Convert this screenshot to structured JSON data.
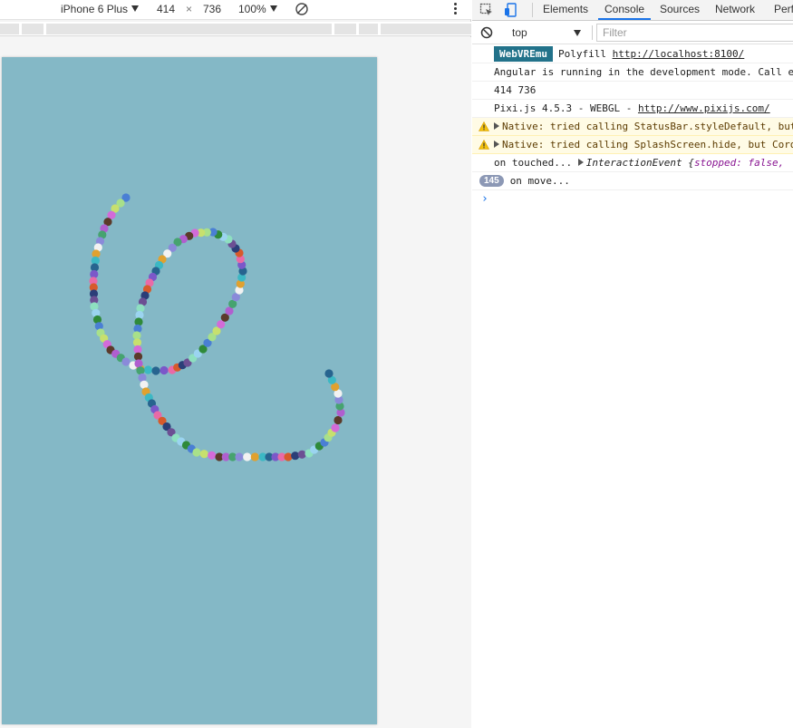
{
  "device_toolbar": {
    "device": "iPhone 6 Plus",
    "width": "414",
    "times": "×",
    "height": "736",
    "zoom": "100%"
  },
  "canvas": {
    "background": "#84b8c6",
    "dot_colors": [
      "#4a7fd4",
      "#d36bd8",
      "#46a36f",
      "#e0a12f",
      "#7b58c9",
      "#2b3e78",
      "#9bd4f0",
      "#a8e08a",
      "#5b3a2a",
      "#8a8ad9",
      "#3cb8c4",
      "#e96aa7",
      "#6c4f93",
      "#2f8a3a",
      "#c7e06e",
      "#b05fcf",
      "#f2f2f2",
      "#27648f",
      "#d75a2b",
      "#8ee0c0"
    ]
  },
  "devtools": {
    "tabs": [
      {
        "label": "Elements"
      },
      {
        "label": "Console"
      },
      {
        "label": "Sources"
      },
      {
        "label": "Network"
      },
      {
        "label": "Perf"
      }
    ],
    "active_tab": "Console",
    "context": "top",
    "filter_placeholder": "Filter",
    "console": {
      "line1": {
        "badge": "WebVREmu",
        "text": "Polyfill",
        "link": "http://localhost:8100/"
      },
      "line2": {
        "text": "Angular is running in the development mode. Call e"
      },
      "line3": {
        "text": "414 736"
      },
      "line4": {
        "text": "Pixi.js 4.5.3 - WEBGL - ",
        "link": "http://www.pixijs.com/"
      },
      "line5": {
        "text": "Native: tried calling StatusBar.styleDefault, but"
      },
      "line6": {
        "text": "Native: tried calling SplashScreen.hide, but Cord"
      },
      "line7": {
        "prefix": "on touched... ",
        "object": "InteractionEvent {",
        "key": "stopped",
        "value": ": false, "
      },
      "line8": {
        "count": "145",
        "text": "on move..."
      }
    }
  }
}
